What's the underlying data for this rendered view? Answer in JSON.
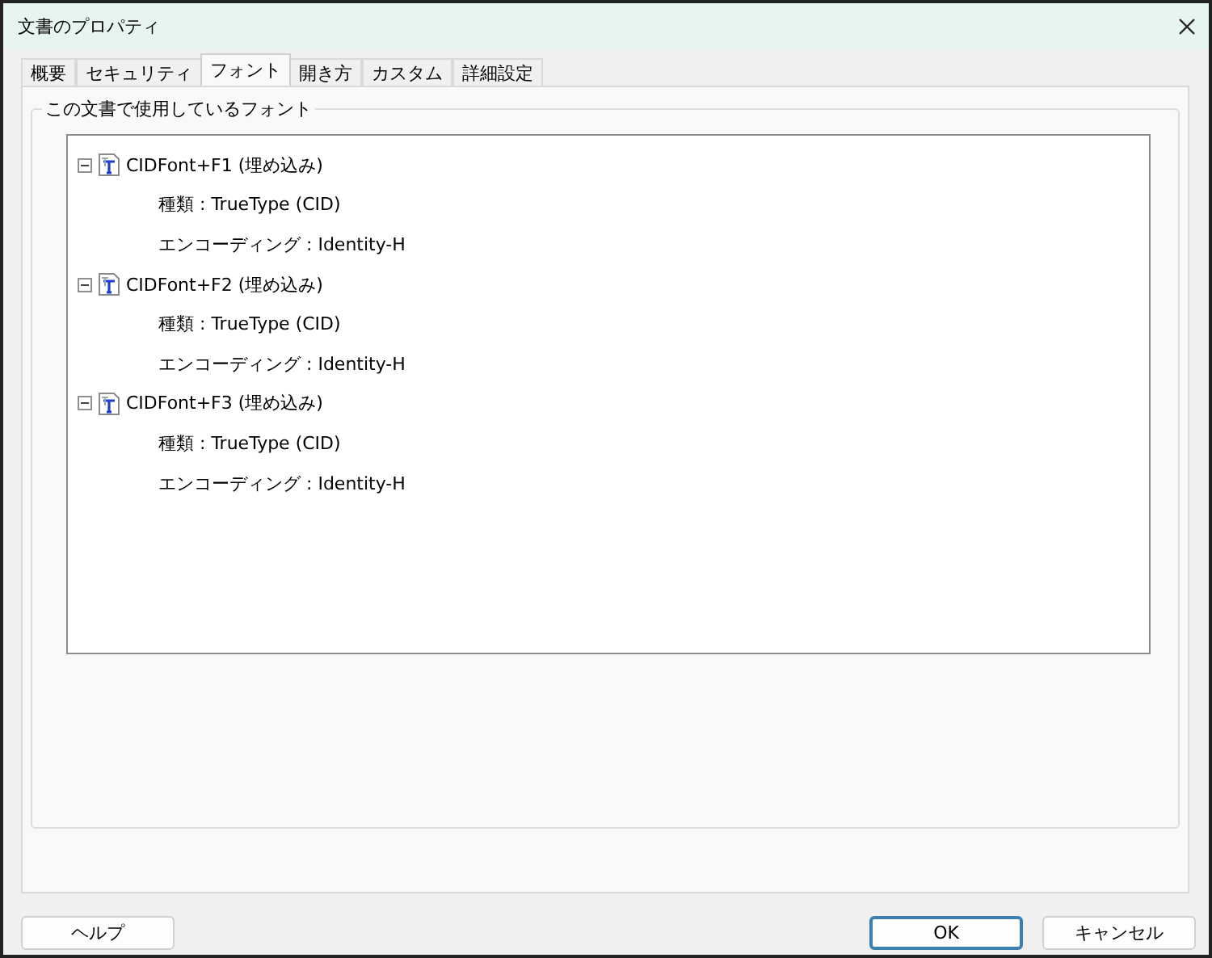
{
  "window": {
    "title": "文書のプロパティ"
  },
  "tabs": [
    {
      "label": "概要",
      "selected": false
    },
    {
      "label": "セキュリティ",
      "selected": false
    },
    {
      "label": "フォント",
      "selected": true
    },
    {
      "label": "開き方",
      "selected": false
    },
    {
      "label": "カスタム",
      "selected": false
    },
    {
      "label": "詳細設定",
      "selected": false
    }
  ],
  "fonts_group": {
    "label": "この文書で使用しているフォント",
    "tree": [
      {
        "label": "CIDFont+F1 (埋め込み)",
        "expanded": true,
        "children": [
          {
            "label": "種類 : TrueType (CID)"
          },
          {
            "label": "エンコーディング : Identity-H"
          }
        ]
      },
      {
        "label": "CIDFont+F2 (埋め込み)",
        "expanded": true,
        "children": [
          {
            "label": "種類 : TrueType (CID)"
          },
          {
            "label": "エンコーディング : Identity-H"
          }
        ]
      },
      {
        "label": "CIDFont+F3 (埋め込み)",
        "expanded": true,
        "children": [
          {
            "label": "種類 : TrueType (CID)"
          },
          {
            "label": "エンコーディング : Identity-H"
          }
        ]
      }
    ]
  },
  "buttons": [
    {
      "label": "ヘルプ",
      "default": false,
      "kind": "left"
    },
    {
      "label": "OK",
      "default": true,
      "kind": "right"
    },
    {
      "label": "キャンセル",
      "default": false,
      "kind": "right"
    }
  ]
}
